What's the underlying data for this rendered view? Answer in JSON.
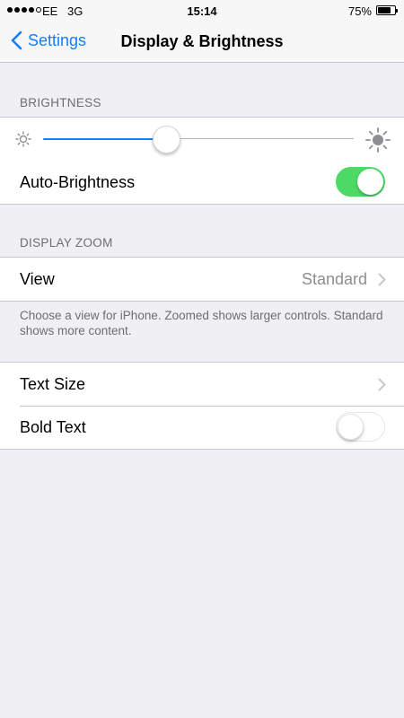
{
  "status_bar": {
    "carrier": "EE",
    "network": "3G",
    "time": "15:14",
    "battery_percent": "75%",
    "battery_level": 0.75
  },
  "nav": {
    "back_label": "Settings",
    "title": "Display & Brightness"
  },
  "brightness": {
    "header": "BRIGHTNESS",
    "slider_level": 0.4,
    "auto_label": "Auto-Brightness",
    "auto_on": true
  },
  "display_zoom": {
    "header": "DISPLAY ZOOM",
    "view_label": "View",
    "view_value": "Standard",
    "note": "Choose a view for iPhone. Zoomed shows larger controls. Standard shows more content."
  },
  "text": {
    "text_size_label": "Text Size",
    "bold_text_label": "Bold Text",
    "bold_on": false
  },
  "colors": {
    "accent": "#147efb",
    "toggle_on": "#4cd964",
    "background": "#efeff4"
  }
}
